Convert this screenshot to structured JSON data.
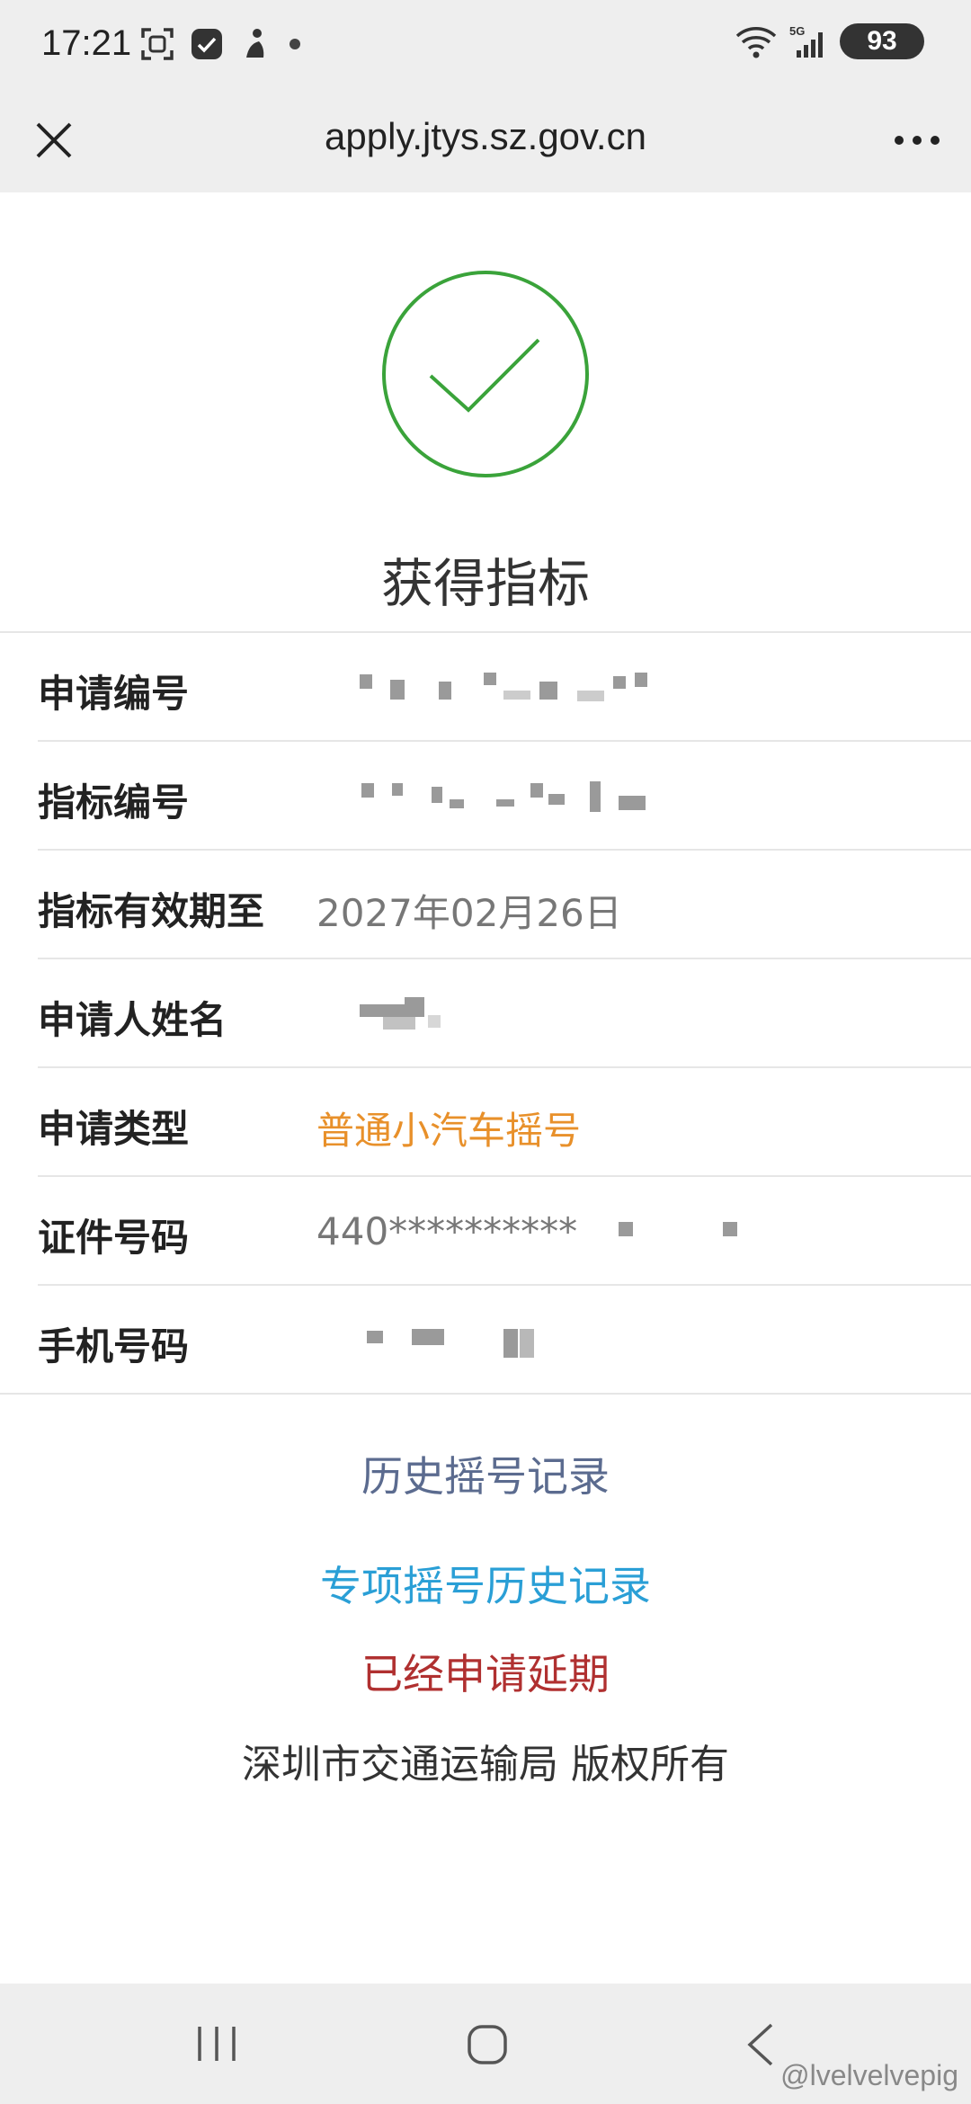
{
  "status_bar": {
    "time": "17:21",
    "battery": "93",
    "network": "5G",
    "icons_left": [
      "scan-icon",
      "app-icon",
      "figure-icon",
      "dot-icon"
    ],
    "icons_right": [
      "wifi-icon",
      "signal-icon",
      "battery-icon"
    ]
  },
  "browser": {
    "url": "apply.jtys.sz.gov.cn",
    "close_icon": "close-icon",
    "more_icon": "more-icon"
  },
  "result": {
    "icon": "check-icon",
    "accent_color": "#3aa33a",
    "title": "获得指标"
  },
  "info": {
    "application_no_label": "申请编号",
    "quota_no_label": "指标编号",
    "valid_until_label": "指标有效期至",
    "valid_until_value": "2027年02月26日",
    "applicant_name_label": "申请人姓名",
    "application_type_label": "申请类型",
    "application_type_value": "普通小汽车摇号",
    "id_no_label": "证件号码",
    "id_no_value": "440**********",
    "phone_label": "手机号码"
  },
  "links": {
    "history": "历史摇号记录",
    "special_history": "专项摇号历史记录",
    "extended": "已经申请延期"
  },
  "footer": {
    "copyright": "深圳市交通运输局 版权所有"
  },
  "watermark": "@lvelvelvepig"
}
